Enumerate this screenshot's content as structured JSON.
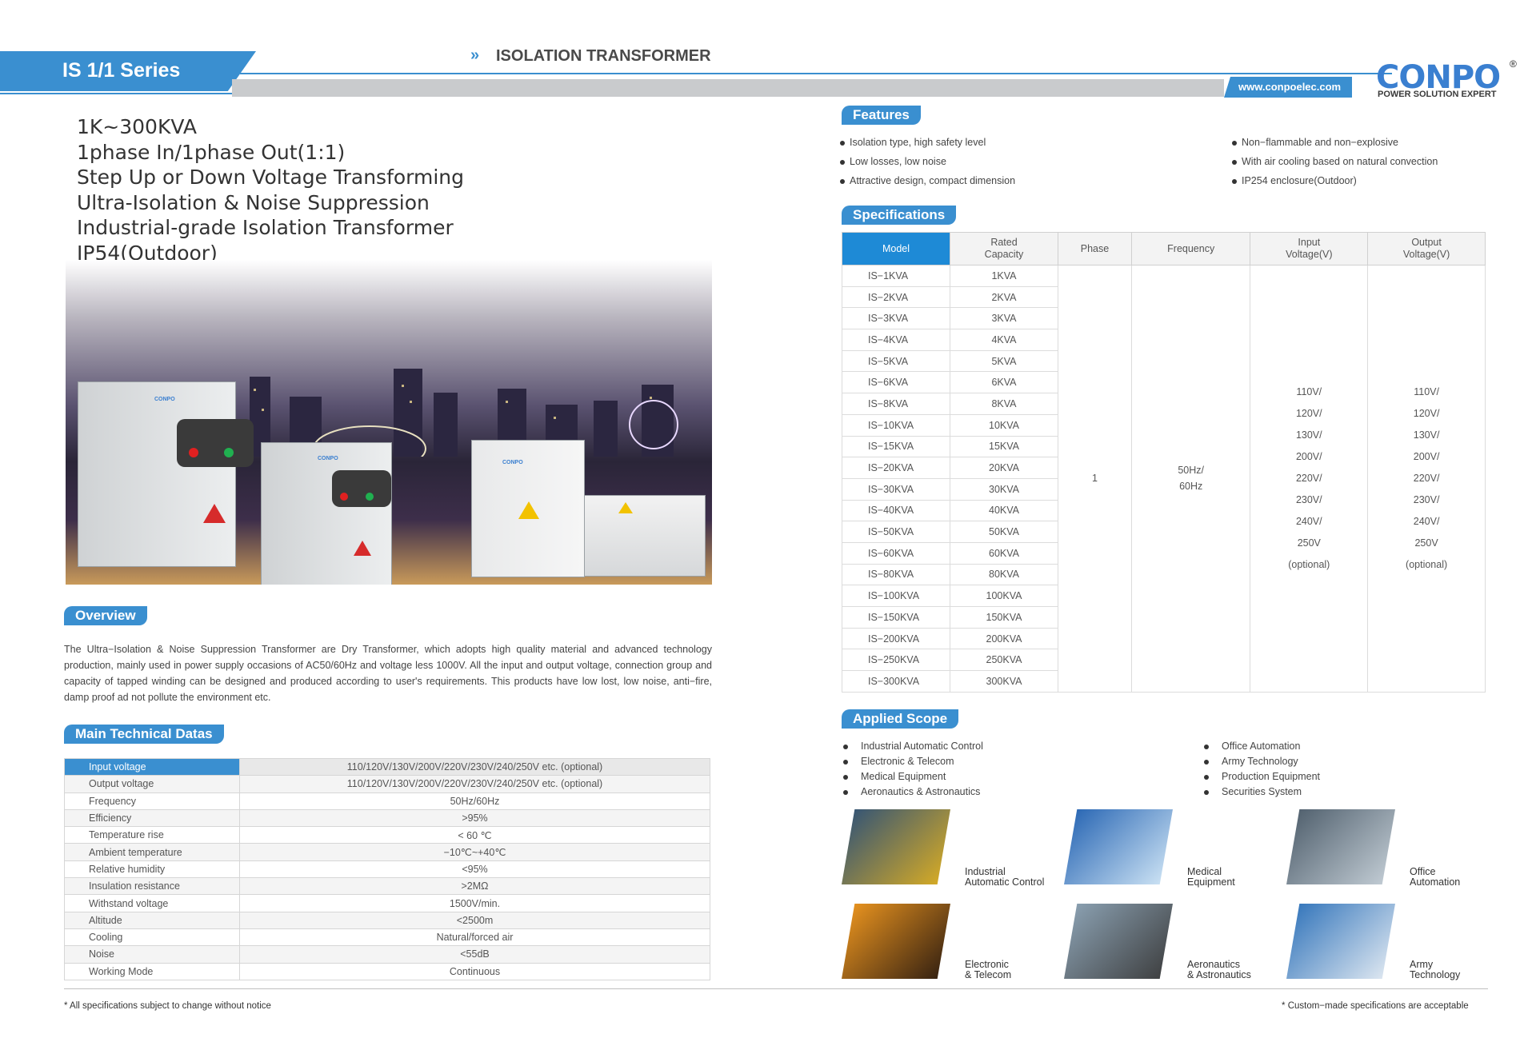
{
  "header": {
    "series": "IS 1/1 Series",
    "chevron": "»",
    "title": "ISOLATION TRANSFORMER",
    "url": "www.conpoelec.com",
    "logo": "CONPO",
    "logo_mark": "®",
    "tagline": "POWER SOLUTION EXPERT"
  },
  "headline": [
    "1K~300KVA",
    "1phase In/1phase Out(1:1)",
    "Step Up or Down Voltage Transforming",
    "Ultra-Isolation & Noise Suppression",
    "Industrial-grade Isolation Transformer",
    "IP54(Outdoor)"
  ],
  "cabinet_logo": "CONPO",
  "overview": {
    "title": "Overview",
    "text": "The Ultra−Isolation & Noise Suppression Transformer are Dry Transformer, which adopts high quality material and advanced technology production, mainly used in power supply occasions of AC50/60Hz and voltage less 1000V.  All the input and output voltage, connection group and capacity of tapped winding can be designed and produced according to user's requirements. This products have low lost, low noise, anti−fire, damp proof ad not pollute the environment etc."
  },
  "tech": {
    "title": "Main Technical Datas",
    "rows": [
      {
        "k": "Input voltage",
        "v": "110/120V/130V/200V/220V/230V/240/250V etc. (optional)"
      },
      {
        "k": "Output voltage",
        "v": "110/120V/130V/200V/220V/230V/240/250V etc. (optional)"
      },
      {
        "k": "Frequency",
        "v": "50Hz/60Hz"
      },
      {
        "k": "Efficiency",
        "v": ">95%"
      },
      {
        "k": "Temperature rise",
        "v": "< 60 ℃"
      },
      {
        "k": "Ambient temperature",
        "v": "−10℃~+40℃"
      },
      {
        "k": "Relative humidity",
        "v": "<95%"
      },
      {
        "k": "Insulation resistance",
        "v": ">2MΩ"
      },
      {
        "k": "Withstand voltage",
        "v": "1500V/min."
      },
      {
        "k": "Altitude",
        "v": "<2500m"
      },
      {
        "k": "Cooling",
        "v": "Natural/forced air"
      },
      {
        "k": "Noise",
        "v": "<55dB"
      },
      {
        "k": "Working Mode",
        "v": "Continuous"
      }
    ]
  },
  "footer": {
    "left": "All specifications subject to change without notice",
    "right": "Custom−made specifications are acceptable",
    "star": "*"
  },
  "features": {
    "title": "Features",
    "left": [
      "Isolation type, high safety level",
      "Low losses, low noise",
      "Attractive design, compact dimension"
    ],
    "right": [
      "Non−flammable and non−explosive",
      "With air cooling based on natural convection",
      "IP254 enclosure(Outdoor)"
    ]
  },
  "specs": {
    "title": "Specifications",
    "headers": {
      "model": "Model",
      "capacity": [
        "Rated",
        "Capacity"
      ],
      "phase": "Phase",
      "frequency": "Frequency",
      "input": [
        "Input",
        "Voltage(V)"
      ],
      "output": [
        "Output",
        "Voltage(V)"
      ]
    },
    "rows": [
      [
        "IS−1KVA",
        "1KVA"
      ],
      [
        "IS−2KVA",
        "2KVA"
      ],
      [
        "IS−3KVA",
        "3KVA"
      ],
      [
        "IS−4KVA",
        "4KVA"
      ],
      [
        "IS−5KVA",
        "5KVA"
      ],
      [
        "IS−6KVA",
        "6KVA"
      ],
      [
        "IS−8KVA",
        "8KVA"
      ],
      [
        "IS−10KVA",
        "10KVA"
      ],
      [
        "IS−15KVA",
        "15KVA"
      ],
      [
        "IS−20KVA",
        "20KVA"
      ],
      [
        "IS−30KVA",
        "30KVA"
      ],
      [
        "IS−40KVA",
        "40KVA"
      ],
      [
        "IS−50KVA",
        "50KVA"
      ],
      [
        "IS−60KVA",
        "60KVA"
      ],
      [
        "IS−80KVA",
        "80KVA"
      ],
      [
        "IS−100KVA",
        "100KVA"
      ],
      [
        "IS−150KVA",
        "150KVA"
      ],
      [
        "IS−200KVA",
        "200KVA"
      ],
      [
        "IS−250KVA",
        "250KVA"
      ],
      [
        "IS−300KVA",
        "300KVA"
      ]
    ],
    "phase": "1",
    "frequency": [
      "50Hz/",
      "60Hz"
    ],
    "input": [
      "110V/",
      "120V/",
      "130V/",
      "200V/",
      "220V/",
      "230V/",
      "240V/",
      "250V",
      "(optional)"
    ],
    "output": [
      "110V/",
      "120V/",
      "130V/",
      "200V/",
      "220V/",
      "230V/",
      "240V/",
      "250V",
      "(optional)"
    ]
  },
  "scope": {
    "title": "Applied Scope",
    "left": [
      "Industrial Automatic Control",
      "Electronic & Telecom",
      "Medical Equipment",
      "Aeronautics & Astronautics"
    ],
    "right": [
      "Office Automation",
      "Army Technology",
      "Production Equipment",
      "Securities System"
    ],
    "tiles": [
      {
        "l1": "Industrial",
        "l2": "Automatic Control",
        "c1": "#2a4f7a",
        "c2": "#e0b020"
      },
      {
        "l1": "Medical",
        "l2": "Equipment",
        "c1": "#1f5fb0",
        "c2": "#d6eaf8"
      },
      {
        "l1": "Office",
        "l2": "Automation",
        "c1": "#4a5a68",
        "c2": "#c8d2da"
      },
      {
        "l1": "Electronic",
        "l2": "& Telecom",
        "c1": "#f39a20",
        "c2": "#2a1a10"
      },
      {
        "l1": "Aeronautics",
        "l2": "& Astronautics",
        "c1": "#8fa6b8",
        "c2": "#3a3a3a"
      },
      {
        "l1": "Army",
        "l2": "Technology",
        "c1": "#2a6fb8",
        "c2": "#e8eef4"
      }
    ]
  }
}
